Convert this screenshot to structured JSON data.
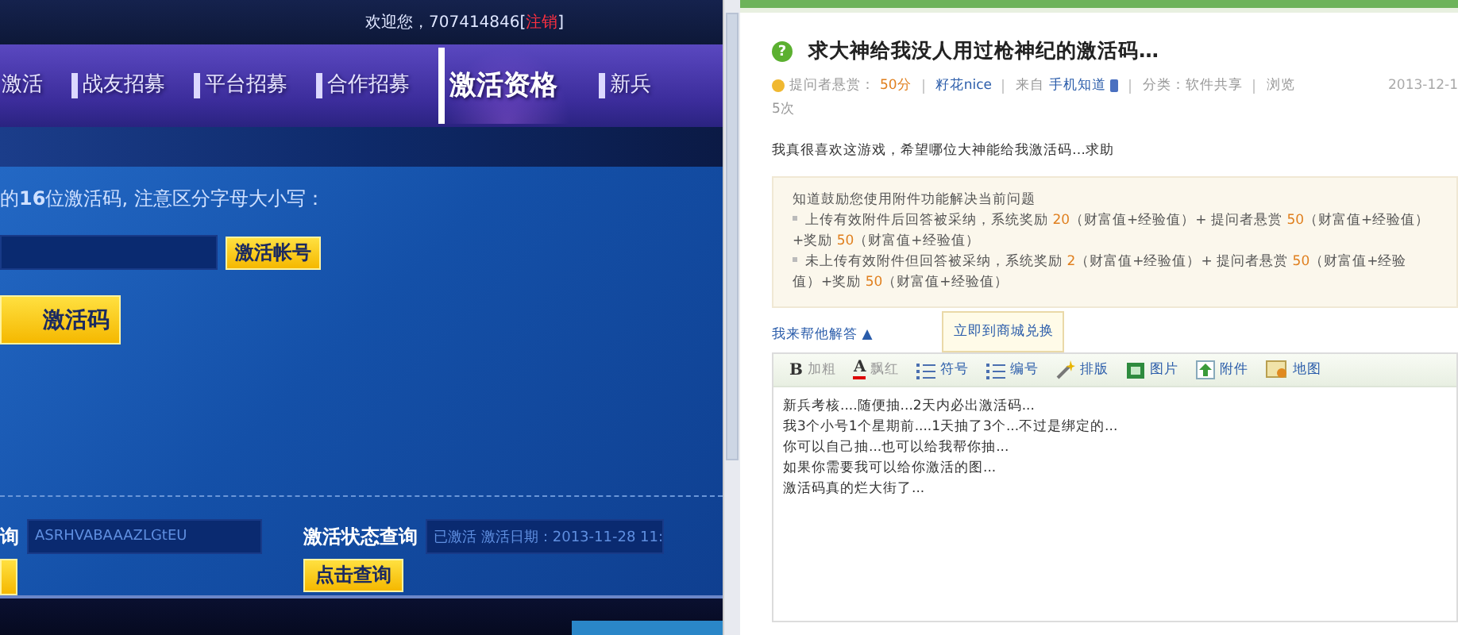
{
  "left_site": {
    "welcome": {
      "text": "欢迎您，707414846[",
      "logout": "注销",
      "close": "]"
    },
    "nav": [
      {
        "label": "激活",
        "selected": false
      },
      {
        "label": "战友招募",
        "selected": false
      },
      {
        "label": "平台招募",
        "selected": false
      },
      {
        "label": "合作招募",
        "selected": false
      },
      {
        "label": "激活资格",
        "selected": true
      },
      {
        "label": "新兵",
        "selected": false
      }
    ],
    "instruction": "的**16**位激活码, 注意区分字母大小写：",
    "activate_button": "激活帐号",
    "get_code_button": "激活码",
    "code_query": {
      "label": "询",
      "value": "ASRHVABAAAZLGtEU"
    },
    "status_query": {
      "label": "激活状态查询",
      "value": "已激活 激活日期：2013-11-28 11:",
      "button": "点击查询"
    }
  },
  "question": {
    "icon": "?",
    "title": "求大神给我没人用过枪神纪的激活码…",
    "reward_label": "提问者悬赏：",
    "reward": "50分",
    "asker": "籽花nice",
    "source_prefix": "来自",
    "source": "手机知道",
    "category": "分类：软件共享",
    "views_label": "浏览",
    "date": "2013-12-1",
    "views": "5次",
    "body": "我真很喜欢这游戏，希望哪位大神能给我激活码…求助"
  },
  "notice": {
    "heading": "知道鼓励您使用附件功能解决当前问题",
    "items": [
      [
        {
          "text": "上传有效附件后回答被采纳，系统奖励 ",
          "highlight": false
        },
        {
          "text": "20",
          "highlight": true
        },
        {
          "text": "（财富值+经验值）+ 提问者悬赏 ",
          "highlight": false
        },
        {
          "text": "50",
          "highlight": true
        },
        {
          "text": "（财富值+经验值）+",
          "highlight": false
        },
        {
          "text": "奖励 ",
          "highlight": false
        },
        {
          "text": "50",
          "highlight": true
        },
        {
          "text": "（财富值+经验值）",
          "highlight": false
        }
      ],
      [
        {
          "text": "未上传有效附件但回答被采纳，系统奖励 ",
          "highlight": false
        },
        {
          "text": "2",
          "highlight": true
        },
        {
          "text": "（财富值+经验值）+ 提问者悬赏 ",
          "highlight": false
        },
        {
          "text": "50",
          "highlight": true
        },
        {
          "text": "（财富值+经验值）+",
          "highlight": false
        },
        {
          "text": "奖励 ",
          "highlight": false
        },
        {
          "text": "50",
          "highlight": true
        },
        {
          "text": "（财富值+经验值）",
          "highlight": false
        }
      ]
    ]
  },
  "answer_toggle": "我来帮他解答 ▲",
  "tooltip": "立即到商城兑换",
  "toolbar": [
    {
      "kind": "bold",
      "glyph": "B",
      "label": "加粗"
    },
    {
      "kind": "red",
      "glyph": "A",
      "label": "飘红"
    },
    {
      "kind": "bullets",
      "label": "符号"
    },
    {
      "kind": "numbers",
      "label": "编号"
    },
    {
      "kind": "format",
      "label": "排版"
    },
    {
      "kind": "image",
      "label": "图片"
    },
    {
      "kind": "attach",
      "label": "附件"
    },
    {
      "kind": "map",
      "label": "地图"
    }
  ],
  "answer_lines": [
    "新兵考核....随便抽...2天内必出激活码...",
    "我3个小号1个星期前....1天抽了3个...不过是绑定的...",
    "你可以自己抽...也可以给我帮你抽...",
    "如果你需要我可以给你激活的图...",
    "激活码真的烂大街了..."
  ]
}
